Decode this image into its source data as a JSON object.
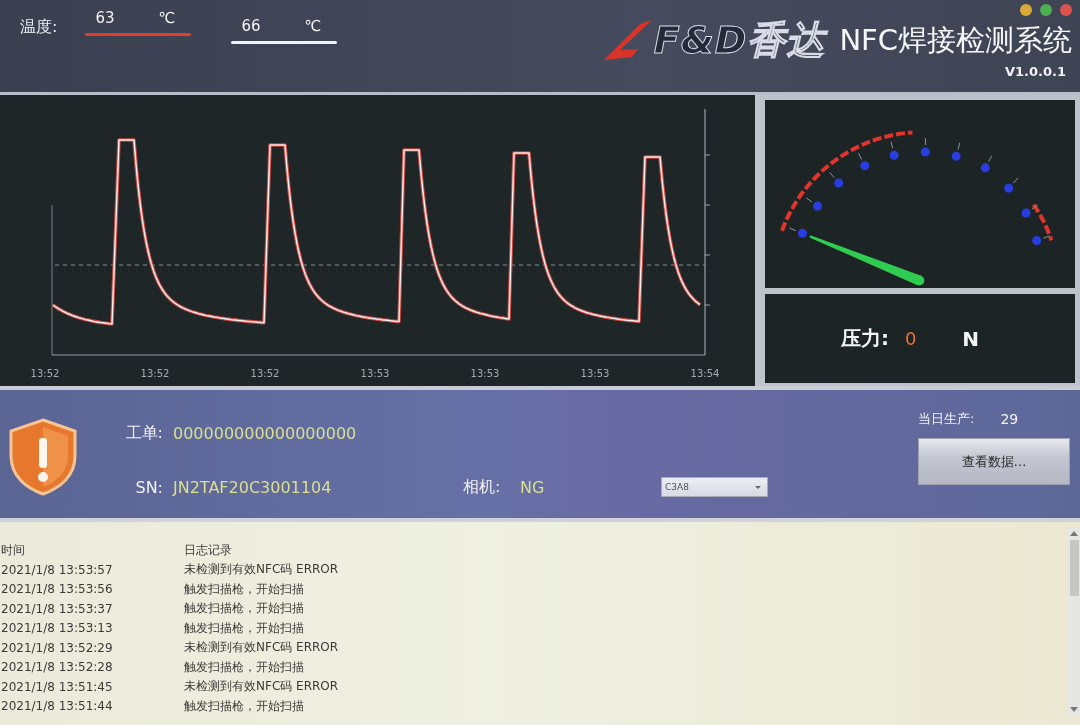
{
  "window": {
    "controls": [
      {
        "color": "#d9a93a"
      },
      {
        "color": "#4caf50"
      },
      {
        "color": "#d9534f"
      }
    ]
  },
  "header": {
    "temperature_label": "温度:",
    "temperatures": [
      {
        "value": "63",
        "unit": "℃",
        "color": "#e0402a"
      },
      {
        "value": "66",
        "unit": "℃",
        "color": "#f2f2f2"
      }
    ],
    "logo_text": "F&D香达",
    "title": "NFC焊接检测系统",
    "version": "V1.0.0.1"
  },
  "waveform": {
    "x_labels": [
      "13:52",
      "13:52",
      "13:52",
      "13:53",
      "13:53",
      "13:53",
      "13:54"
    ]
  },
  "pressure": {
    "label": "压力:",
    "value": "0",
    "unit": "N"
  },
  "work_order": {
    "label": "工单:",
    "value": "000000000000000000"
  },
  "sn": {
    "label": "SN:",
    "value": "JN2TAF20C3001104"
  },
  "camera": {
    "label": "相机:",
    "value": "NG"
  },
  "select": {
    "value": "C3A8"
  },
  "daily_output": {
    "label": "当日生产:",
    "value": "29"
  },
  "view_data_button": "查看数据…",
  "log": {
    "columns": [
      "时间",
      "日志记录"
    ],
    "rows": [
      {
        "time": "2021/1/8 13:53:57",
        "message": "未检测到有效NFC码 ERROR"
      },
      {
        "time": "2021/1/8 13:53:56",
        "message": "触发扫描枪，开始扫描"
      },
      {
        "time": "2021/1/8 13:53:37",
        "message": "触发扫描枪，开始扫描"
      },
      {
        "time": "2021/1/8 13:53:13",
        "message": "触发扫描枪，开始扫描"
      },
      {
        "time": "2021/1/8 13:52:29",
        "message": "未检测到有效NFC码 ERROR"
      },
      {
        "time": "2021/1/8 13:52:28",
        "message": "触发扫描枪，开始扫描"
      },
      {
        "time": "2021/1/8 13:51:45",
        "message": "未检测到有效NFC码 ERROR"
      },
      {
        "time": "2021/1/8 13:51:44",
        "message": "触发扫描枪，开始扫描"
      }
    ]
  }
}
